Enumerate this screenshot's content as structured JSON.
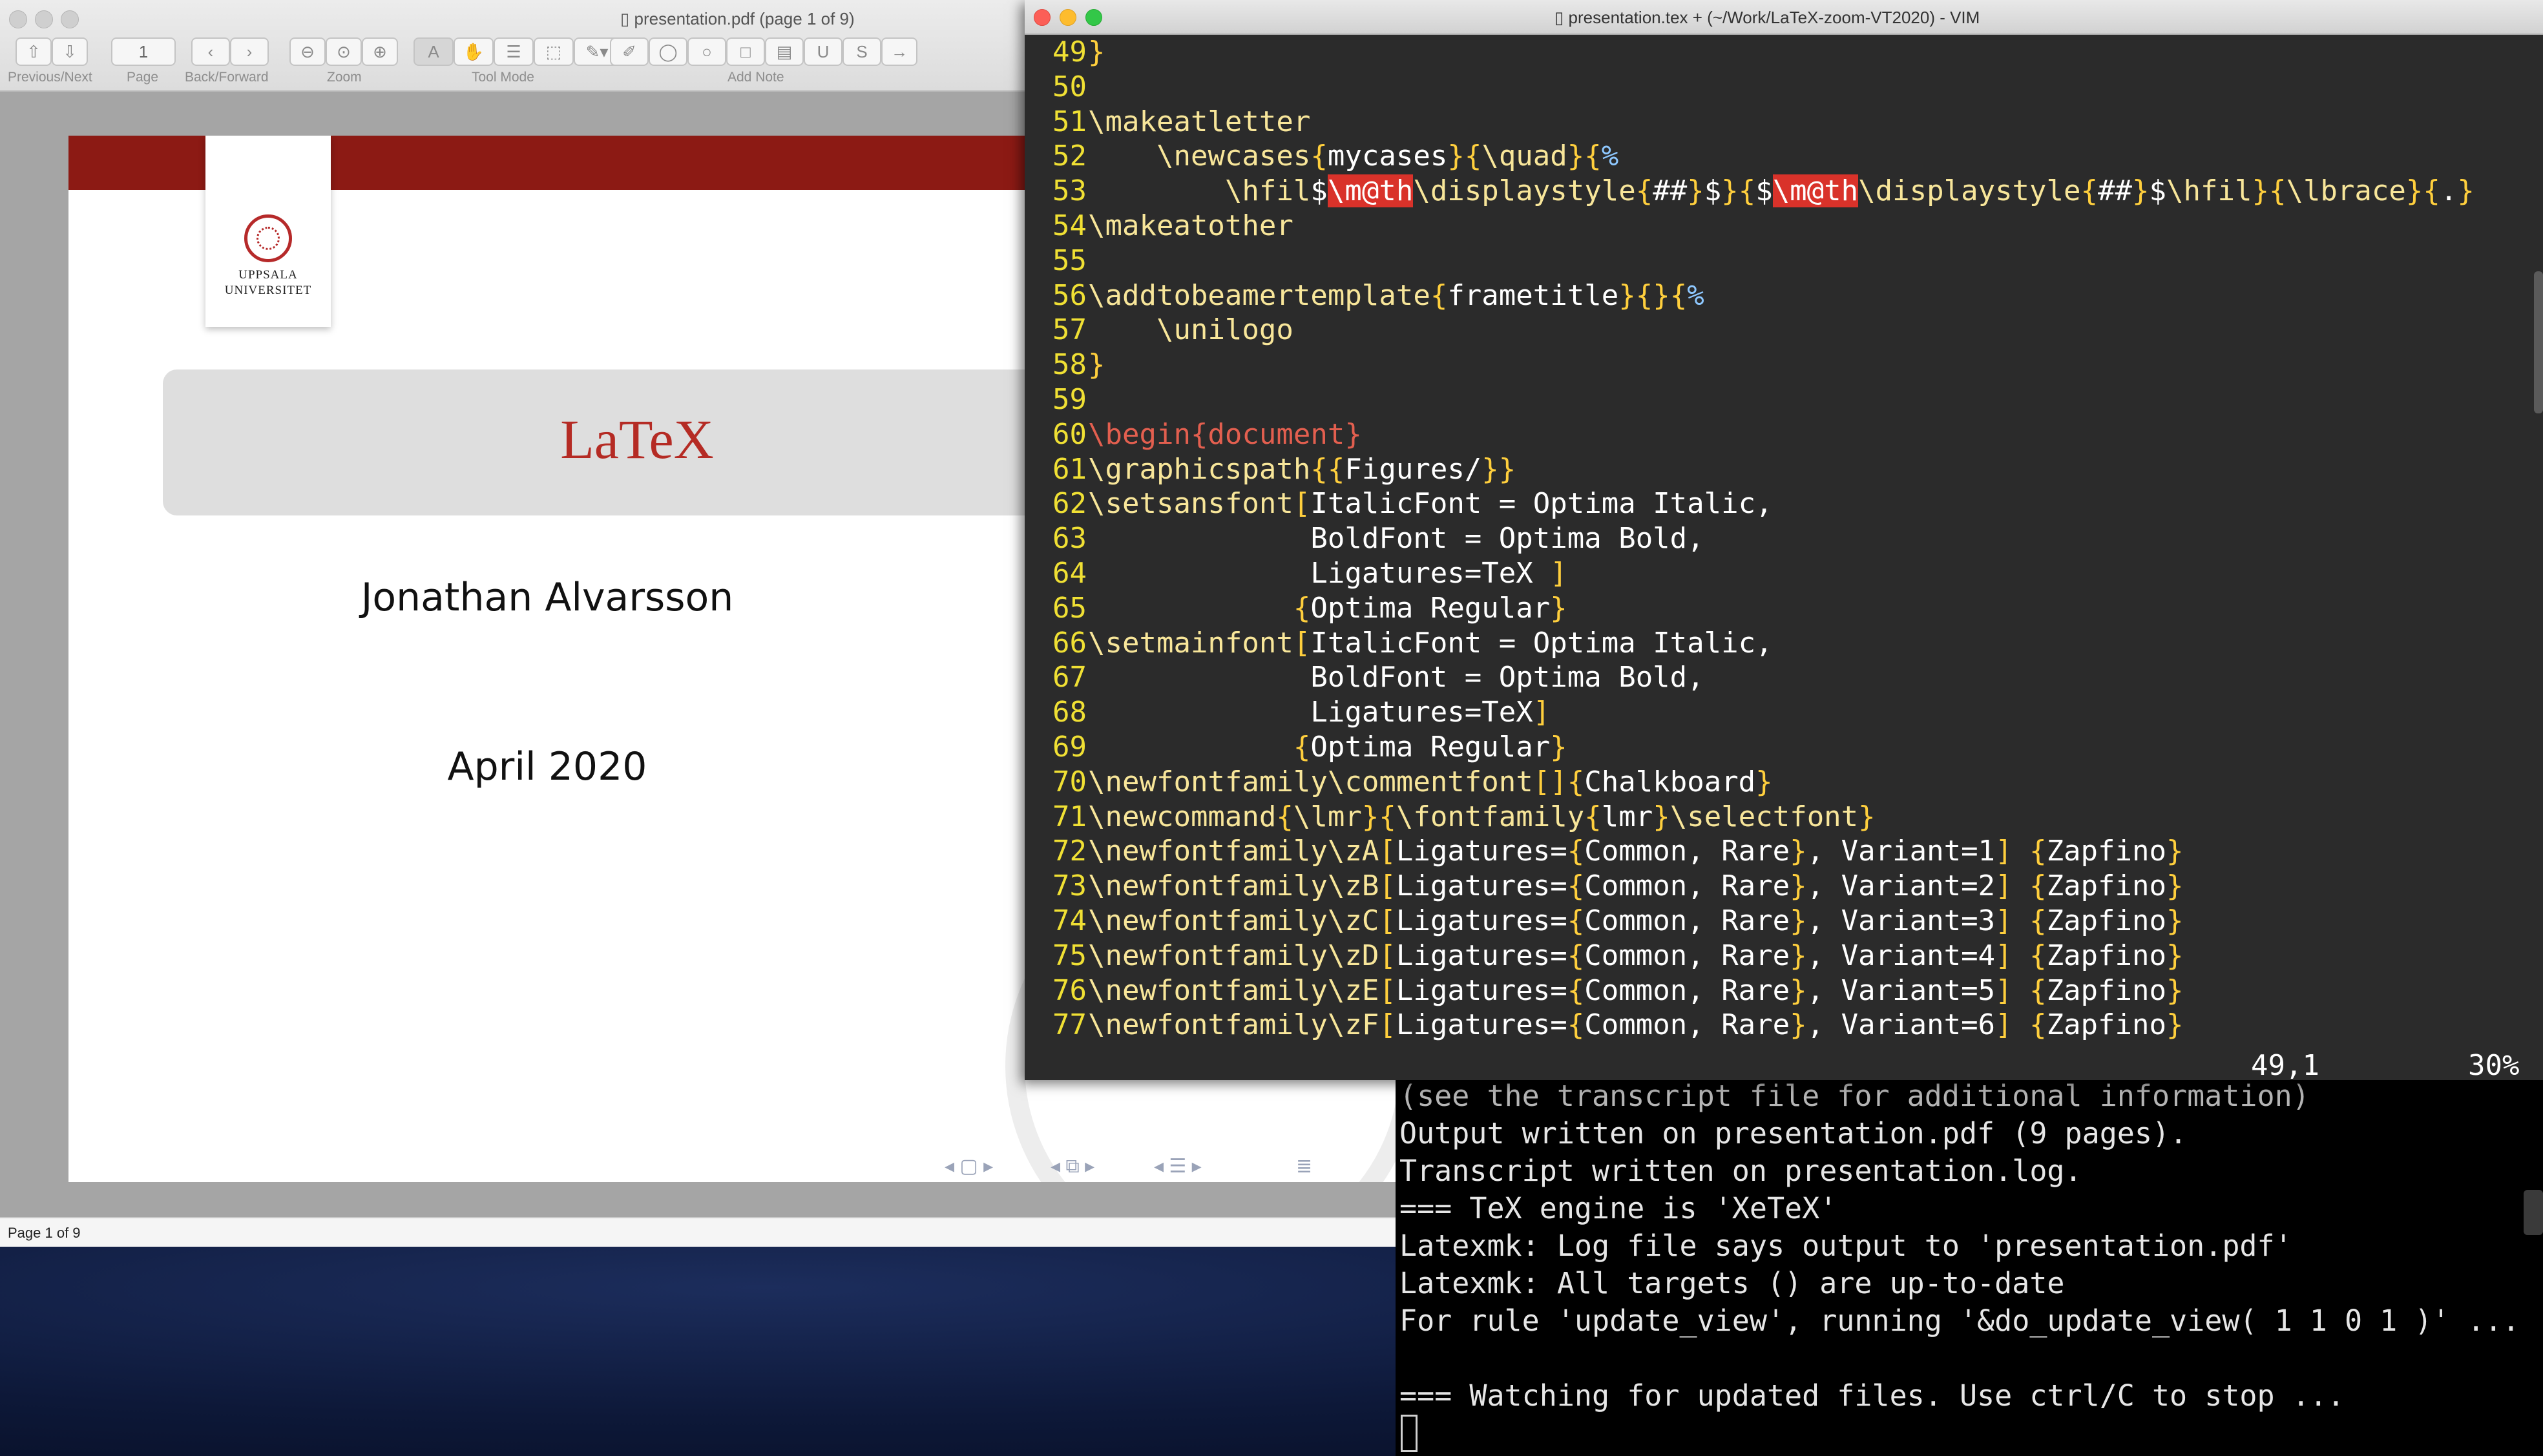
{
  "preview": {
    "window_title": "presentation.pdf (page 1 of 9)",
    "page_field": "1",
    "toolbar_labels": {
      "prev_next": "Previous/Next",
      "page": "Page",
      "back_forward": "Back/Forward",
      "zoom": "Zoom",
      "tool_mode": "Tool Mode",
      "add_note": "Add Note"
    },
    "slide": {
      "logo_line1": "UPPSALA",
      "logo_line2": "UNIVERSITET",
      "title": "LaTeX",
      "author": "Jonathan Alvarsson",
      "date": "April 2020"
    },
    "status": "Page 1 of 9"
  },
  "vim": {
    "window_title": "presentation.tex + (~/Work/LaTeX-zoom-VT2020) - VIM",
    "lines": [
      {
        "n": "49",
        "t": "}"
      },
      {
        "n": "50",
        "t": ""
      },
      {
        "n": "51",
        "t": "\\makeatletter"
      },
      {
        "n": "52",
        "t": "    \\newcases{mycases}{\\quad}{%"
      },
      {
        "n": "53",
        "t": "        \\hfil$\\m@th\\displaystyle{##}$}{$\\m@th\\displaystyle{##}$\\hfil}{\\lbrace}{.}"
      },
      {
        "n": "54",
        "t": "\\makeatother"
      },
      {
        "n": "55",
        "t": ""
      },
      {
        "n": "56",
        "t": "\\addtobeamertemplate{frametitle}{}{%"
      },
      {
        "n": "57",
        "t": "    \\unilogo"
      },
      {
        "n": "58",
        "t": "}"
      },
      {
        "n": "59",
        "t": ""
      },
      {
        "n": "60",
        "t": "\\begin{document}"
      },
      {
        "n": "61",
        "t": "\\graphicspath{{Figures/}}"
      },
      {
        "n": "62",
        "t": "\\setsansfont[ItalicFont = Optima Italic,"
      },
      {
        "n": "63",
        "t": "             BoldFont = Optima Bold,"
      },
      {
        "n": "64",
        "t": "             Ligatures=TeX ]"
      },
      {
        "n": "65",
        "t": "            {Optima Regular}"
      },
      {
        "n": "66",
        "t": "\\setmainfont[ItalicFont = Optima Italic,"
      },
      {
        "n": "67",
        "t": "             BoldFont = Optima Bold,"
      },
      {
        "n": "68",
        "t": "             Ligatures=TeX]"
      },
      {
        "n": "69",
        "t": "            {Optima Regular}"
      },
      {
        "n": "70",
        "t": "\\newfontfamily\\commentfont[]{Chalkboard}"
      },
      {
        "n": "71",
        "t": "\\newcommand{\\lmr}{\\fontfamily{lmr}\\selectfont}"
      },
      {
        "n": "72",
        "t": "\\newfontfamily\\zA[Ligatures={Common, Rare}, Variant=1] {Zapfino}"
      },
      {
        "n": "73",
        "t": "\\newfontfamily\\zB[Ligatures={Common, Rare}, Variant=2] {Zapfino}"
      },
      {
        "n": "74",
        "t": "\\newfontfamily\\zC[Ligatures={Common, Rare}, Variant=3] {Zapfino}"
      },
      {
        "n": "75",
        "t": "\\newfontfamily\\zD[Ligatures={Common, Rare}, Variant=4] {Zapfino}"
      },
      {
        "n": "76",
        "t": "\\newfontfamily\\zE[Ligatures={Common, Rare}, Variant=5] {Zapfino}"
      },
      {
        "n": "77",
        "t": "\\newfontfamily\\zF[Ligatures={Common, Rare}, Variant=6] {Zapfino}"
      }
    ],
    "cursor_position": "49,1",
    "scroll_percent": "30%"
  },
  "terminal": {
    "lines": [
      "(see the transcript file for additional information)",
      "Output written on presentation.pdf (9 pages).",
      "Transcript written on presentation.log.",
      "=== TeX engine is 'XeTeX'",
      "Latexmk: Log file says output to 'presentation.pdf'",
      "Latexmk: All targets () are up-to-date",
      "For rule 'update_view', running '&do_update_view( 1 1 0 1 )' ...",
      "",
      "=== Watching for updated files. Use ctrl/C to stop ..."
    ]
  },
  "colors": {
    "vim_background": "#2b2b2b",
    "line_number": "#f0e034",
    "highlight": "#d9322a",
    "slide_band": "#8c1a14",
    "slide_title": "#b52b24"
  }
}
